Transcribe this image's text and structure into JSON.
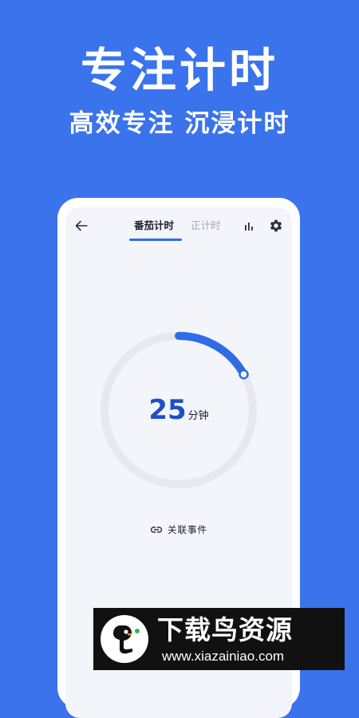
{
  "promo": {
    "title": "专注计时",
    "subtitle": "高效专注 沉浸计时"
  },
  "header": {
    "back_icon": "arrow-left-icon",
    "tabs": [
      {
        "label": "番茄计时",
        "active": true
      },
      {
        "label": "正计时",
        "active": false
      }
    ],
    "stats_icon": "bar-chart-icon",
    "settings_icon": "gear-icon"
  },
  "timer": {
    "value": "25",
    "unit": "分钟",
    "progress_fraction": 0.17
  },
  "link_event": {
    "icon": "link-icon",
    "label": "关联事件"
  },
  "watermark": {
    "name": "下载鸟资源",
    "url": "www.xiazainiao.com"
  },
  "colors": {
    "background": "#3a73ec",
    "accent": "#2f6ce5",
    "timer_text": "#1f4fc2",
    "ring_track": "#e8e9ee",
    "inactive_tab": "#a3a8b3"
  }
}
